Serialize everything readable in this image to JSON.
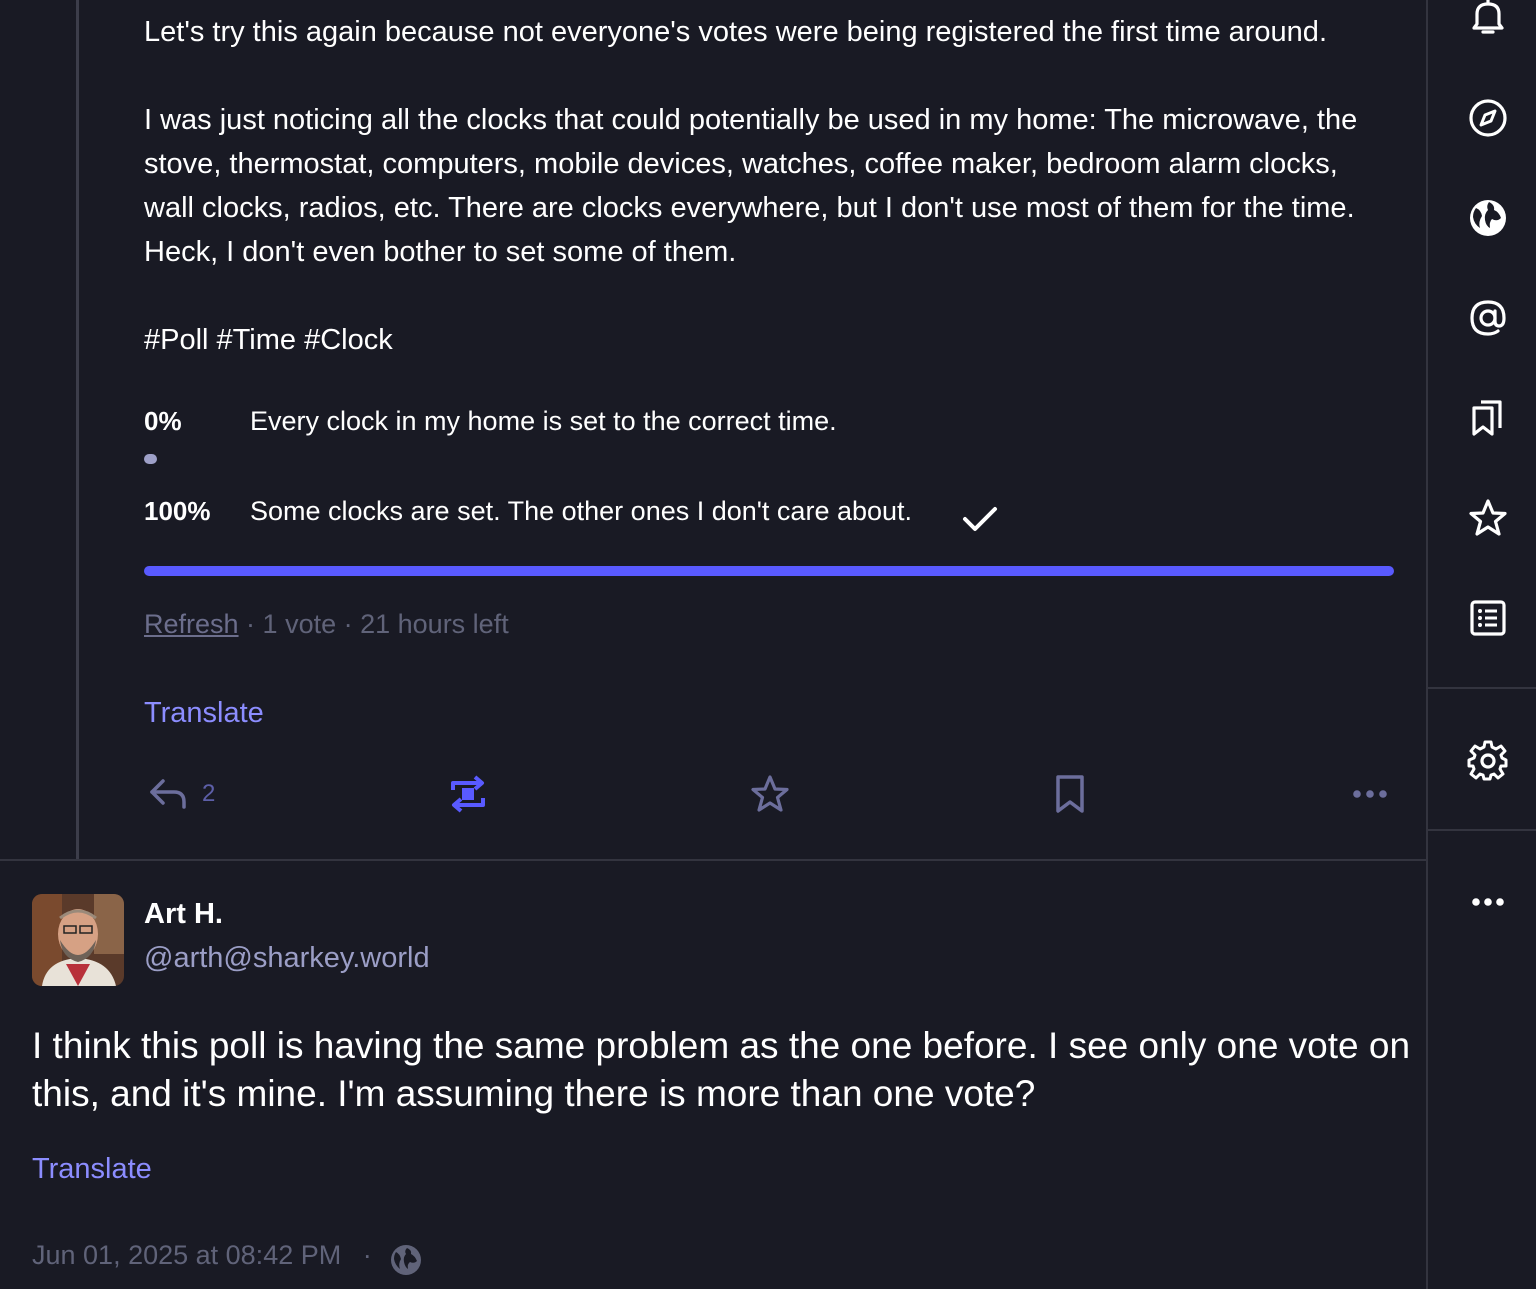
{
  "post": {
    "paragraph1": "Let's try this again because not everyone's votes were being registered the first time around.",
    "paragraph2": "I was just noticing all the clocks that could potentially be used in my home: The microwave, the stove, thermostat, computers, mobile devices, watches, coffee maker, bedroom alarm clocks, wall clocks, radios, etc. There are clocks everywhere, but I don't use most of them for the time. Heck, I don't even bother to set some of them.",
    "hashtags": "#Poll #Time #Clock",
    "poll": {
      "options": [
        {
          "percent_label": "0%",
          "text": "Every clock in my home is set to the correct time.",
          "fraction": 0.0,
          "voted": false
        },
        {
          "percent_label": "100%",
          "text": "Some clocks are set. The other ones I don't care about.",
          "fraction": 1.0,
          "voted": true
        }
      ],
      "refresh_label": "Refresh",
      "separator": " · ",
      "votes": "1 vote",
      "time_left": "21 hours left"
    },
    "translate_label": "Translate",
    "actions": {
      "reply_count": "2"
    }
  },
  "reply": {
    "display_name": "Art H.",
    "handle": "@arth@sharkey.world",
    "text": "I think this poll is having the same problem as the one before. I see only one vote on this, and it's mine. I'm assuming there is more than one vote?",
    "translate_label": "Translate",
    "timestamp": "Jun 01, 2025 at 08:42 PM",
    "separator": "·"
  },
  "sidebar": {
    "icons": [
      "bell-icon",
      "compass-icon",
      "globe-icon",
      "at-icon",
      "bookmarks-icon",
      "star-icon",
      "list-icon",
      "gear-icon",
      "more-icon"
    ]
  },
  "colors": {
    "background": "#191a24",
    "accent": "#595aff",
    "link": "#8c8dff",
    "muted": "#606379"
  }
}
